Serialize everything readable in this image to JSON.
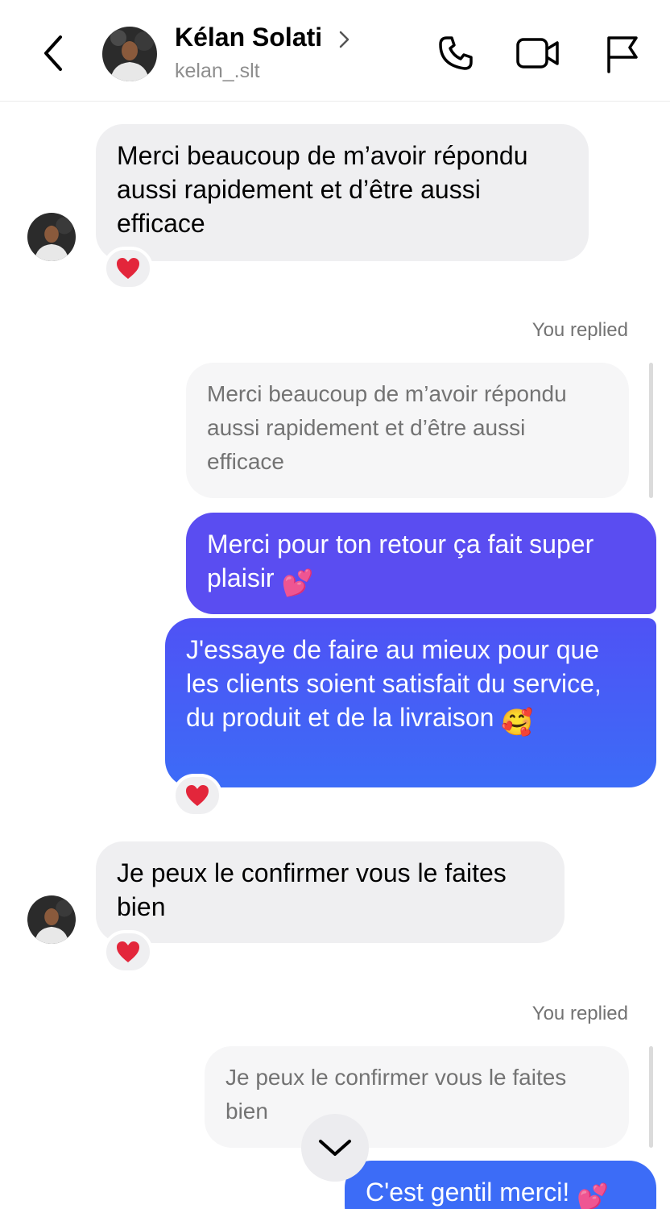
{
  "header": {
    "contact_name": "Kélan Solati",
    "contact_handle": "kelan_.slt"
  },
  "messages": {
    "m1": {
      "text": "Merci beaucoup de m’avoir répondu aussi rapidement et d’être aussi efficace",
      "reaction": "❤️"
    },
    "reply1": {
      "label": "You replied",
      "quote": "Merci beaucoup de m’avoir répondu aussi rapidement et d’être aussi efficace"
    },
    "m2": {
      "text": "Merci pour ton retour ça fait super plaisir",
      "emoji": "💕"
    },
    "m3": {
      "text": "J'essaye de faire au mieux pour que les clients soient satisfait du service, du produit et de la livraison",
      "emoji": "🥰",
      "reaction": "❤️"
    },
    "m4": {
      "text": "Je peux le confirmer vous le faites bien",
      "reaction": "❤️"
    },
    "reply2": {
      "label": "You replied",
      "quote": "Je peux le confirmer vous le faites bien"
    },
    "m5": {
      "text": "C'est gentil merci!",
      "emoji": "💕"
    }
  },
  "colors": {
    "outgoing_top": "#5a4df1",
    "outgoing_mid": "#4f52f5",
    "outgoing_bottom": "#3c6cf7",
    "incoming": "#efeff1",
    "header_text": "#000000",
    "muted_text": "#8e8e8e"
  },
  "icons": [
    "back-chevron-icon",
    "chevron-right-icon",
    "phone-icon",
    "video-camera-icon",
    "flag-icon",
    "heart-reaction-icon",
    "chevron-down-icon"
  ]
}
